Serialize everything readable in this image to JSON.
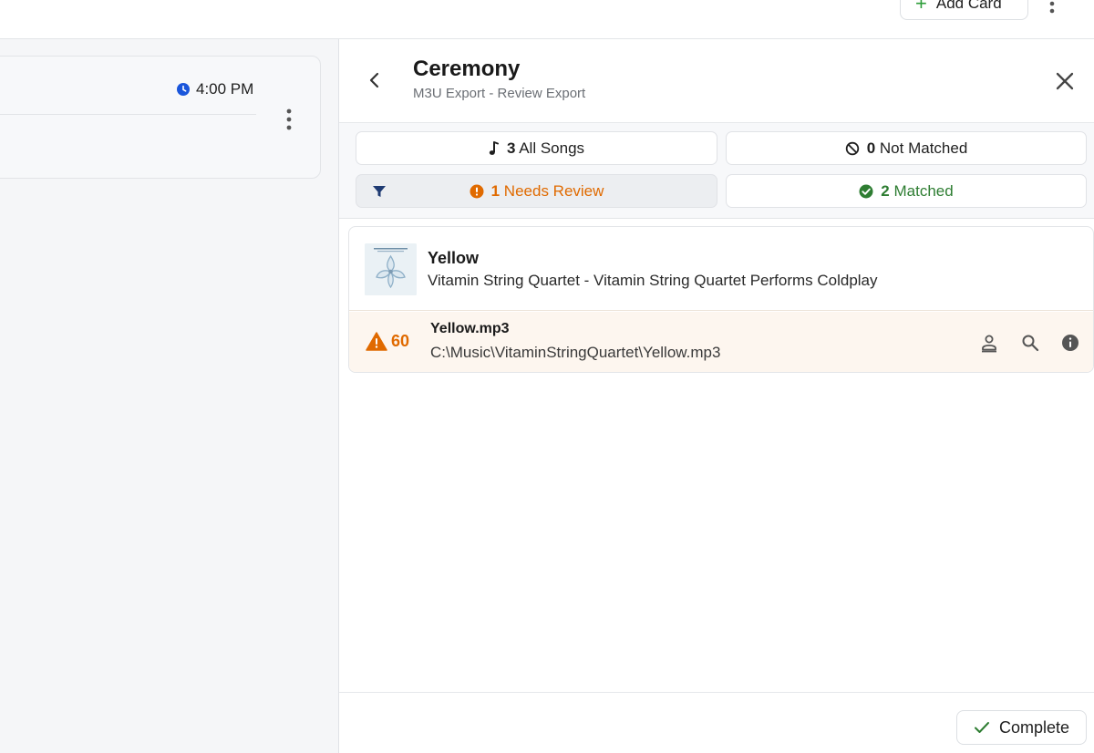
{
  "topbar": {
    "add_card_label": "Add Card"
  },
  "left_card": {
    "time": "4:00 PM"
  },
  "panel": {
    "title": "Ceremony",
    "subtitle": "M3U Export - Review Export"
  },
  "filters": {
    "all": {
      "count": "3",
      "label": "All Songs"
    },
    "not_matched": {
      "count": "0",
      "label": "Not Matched"
    },
    "needs_review": {
      "count": "1",
      "label": "Needs Review"
    },
    "matched": {
      "count": "2",
      "label": "Matched"
    }
  },
  "song": {
    "title": "Yellow",
    "artist_album": "Vitamin String Quartet - Vitamin String Quartet Performs Coldplay",
    "match": {
      "score": "60",
      "file_name": "Yellow.mp3",
      "file_path": "C:\\Music\\VitaminStringQuartet\\Yellow.mp3"
    }
  },
  "footer": {
    "complete_label": "Complete"
  },
  "colors": {
    "review_orange": "#e06a00",
    "matched_green": "#2e7d32",
    "clock_blue": "#1a56db",
    "add_green": "#2e9d3a"
  }
}
